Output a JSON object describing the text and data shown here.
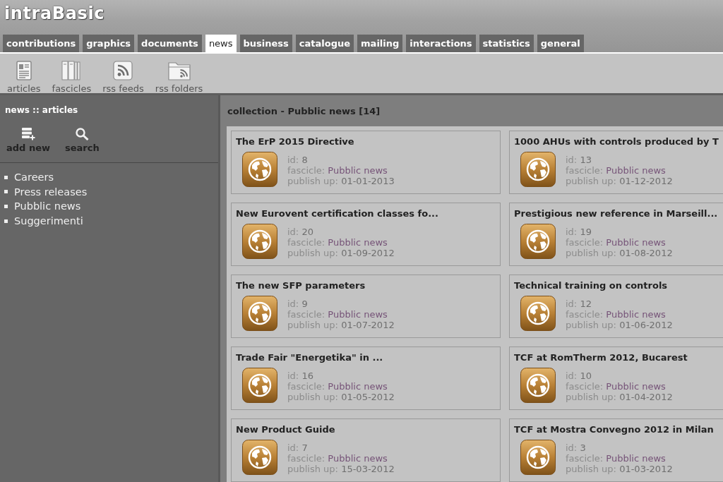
{
  "app": {
    "logo": "intraBasic"
  },
  "tabs": [
    {
      "label": "contributions",
      "selected": false
    },
    {
      "label": "graphics",
      "selected": false
    },
    {
      "label": "documents",
      "selected": false
    },
    {
      "label": "news",
      "selected": true
    },
    {
      "label": "business",
      "selected": false
    },
    {
      "label": "catalogue",
      "selected": false
    },
    {
      "label": "mailing",
      "selected": false
    },
    {
      "label": "interactions",
      "selected": false
    },
    {
      "label": "statistics",
      "selected": false
    },
    {
      "label": "general",
      "selected": false
    }
  ],
  "toolbar": [
    {
      "label": "articles",
      "kind": "document"
    },
    {
      "label": "fascicles",
      "kind": "binders"
    },
    {
      "label": "rss feeds",
      "kind": "feed"
    },
    {
      "label": "rss folders",
      "kind": "feed_folder"
    }
  ],
  "sidebar": {
    "heading": "news :: articles",
    "actions": [
      {
        "label": "add new",
        "kind": "add"
      },
      {
        "label": "search",
        "kind": "search"
      }
    ],
    "items": [
      "Careers",
      "Press releases",
      "Pubblic news",
      "Suggerimenti"
    ]
  },
  "collection": {
    "heading": "collection - Pubblic news [14]",
    "cards": [
      {
        "title": "The ErP 2015 Directive",
        "id": {
          "label": "id:",
          "value": "8"
        },
        "fascicle": {
          "label": "fascicle:",
          "value": "Pubblic news"
        },
        "publish_up": {
          "label": "publish up:",
          "value": "01-01-2013"
        }
      },
      {
        "title": "1000 AHUs with controls produced by T",
        "id": {
          "label": "id:",
          "value": "13"
        },
        "fascicle": {
          "label": "fascicle:",
          "value": "Pubblic news"
        },
        "publish_up": {
          "label": "publish up:",
          "value": "01-12-2012"
        }
      },
      {
        "title": "New Eurovent certification classes fo...",
        "id": {
          "label": "id:",
          "value": "20"
        },
        "fascicle": {
          "label": "fascicle:",
          "value": "Pubblic news"
        },
        "publish_up": {
          "label": "publish up:",
          "value": "01-09-2012"
        }
      },
      {
        "title": "Prestigious new reference in Marseill...",
        "id": {
          "label": "id:",
          "value": "19"
        },
        "fascicle": {
          "label": "fascicle:",
          "value": "Pubblic news"
        },
        "publish_up": {
          "label": "publish up:",
          "value": "01-08-2012"
        }
      },
      {
        "title": "The new SFP parameters",
        "id": {
          "label": "id:",
          "value": "9"
        },
        "fascicle": {
          "label": "fascicle:",
          "value": "Pubblic news"
        },
        "publish_up": {
          "label": "publish up:",
          "value": "01-07-2012"
        }
      },
      {
        "title": "Technical training on controls",
        "id": {
          "label": "id:",
          "value": "12"
        },
        "fascicle": {
          "label": "fascicle:",
          "value": "Pubblic news"
        },
        "publish_up": {
          "label": "publish up:",
          "value": "01-06-2012"
        }
      },
      {
        "title": "Trade Fair \"Energetika\" in ...",
        "id": {
          "label": "id:",
          "value": "16"
        },
        "fascicle": {
          "label": "fascicle:",
          "value": "Pubblic news"
        },
        "publish_up": {
          "label": "publish up:",
          "value": "01-05-2012"
        }
      },
      {
        "title": "TCF at RomTherm 2012, Bucarest",
        "id": {
          "label": "id:",
          "value": "10"
        },
        "fascicle": {
          "label": "fascicle:",
          "value": "Pubblic news"
        },
        "publish_up": {
          "label": "publish up:",
          "value": "01-04-2012"
        }
      },
      {
        "title": "New Product Guide",
        "id": {
          "label": "id:",
          "value": "7"
        },
        "fascicle": {
          "label": "fascicle:",
          "value": "Pubblic news"
        },
        "publish_up": {
          "label": "publish up:",
          "value": "15-03-2012"
        }
      },
      {
        "title": "TCF at Mostra Convegno 2012 in Milan",
        "id": {
          "label": "id:",
          "value": "3"
        },
        "fascicle": {
          "label": "fascicle:",
          "value": "Pubblic news"
        },
        "publish_up": {
          "label": "publish up:",
          "value": "01-03-2012"
        }
      }
    ]
  }
}
